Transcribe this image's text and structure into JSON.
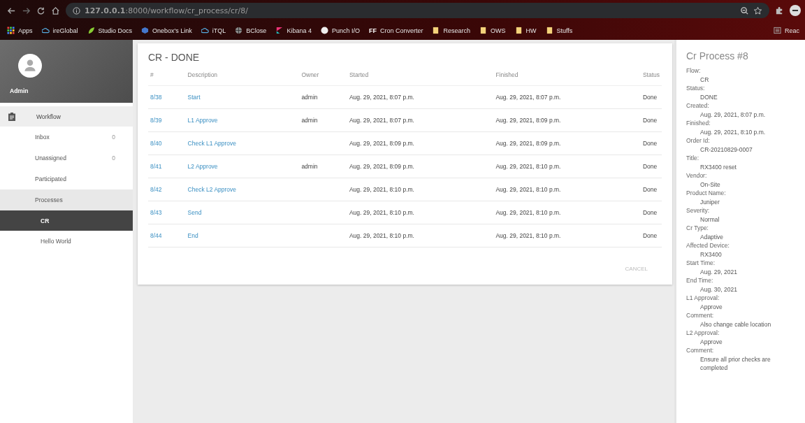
{
  "browser": {
    "url": "**127.0.0.1**:8000/workflow/cr_process/cr/8/",
    "bookmarks": [
      {
        "label": "Apps",
        "kind": "grid"
      },
      {
        "label": "ireGlobal",
        "kind": "cloud"
      },
      {
        "label": "Studio Docs",
        "kind": "leaf"
      },
      {
        "label": "Onebox's Link",
        "kind": "cube"
      },
      {
        "label": "iTQL",
        "kind": "cloud"
      },
      {
        "label": "BClose",
        "kind": "globe"
      },
      {
        "label": "Kibana 4",
        "kind": "kibana"
      },
      {
        "label": "Punch I/O",
        "kind": "disc"
      },
      {
        "label": "Cron Converter",
        "kind": "text",
        "badge": "FF"
      },
      {
        "label": "Research",
        "kind": "folder"
      },
      {
        "label": "OWS",
        "kind": "folder"
      },
      {
        "label": "HW",
        "kind": "folder"
      },
      {
        "label": "Stuffs",
        "kind": "folder"
      }
    ],
    "reading_list": "Reac"
  },
  "sidebar": {
    "user": "Admin",
    "section": "Workflow",
    "items": [
      {
        "label": "Inbox",
        "count": "0",
        "selected": false
      },
      {
        "label": "Unassigned",
        "count": "0",
        "selected": false
      },
      {
        "label": "Participated",
        "selected": false
      },
      {
        "label": "Processes",
        "selected": false,
        "expanded": true,
        "children": [
          {
            "label": "CR",
            "selected": true
          },
          {
            "label": "Hello World",
            "selected": false
          }
        ]
      }
    ]
  },
  "card": {
    "title": "CR - DONE",
    "columns": [
      "#",
      "Description",
      "Owner",
      "Started",
      "Finished",
      "Status"
    ],
    "rows": [
      {
        "id": "8/38",
        "description": "Start",
        "owner": "admin",
        "started": "Aug. 29, 2021, 8:07 p.m.",
        "finished": "Aug. 29, 2021, 8:07 p.m.",
        "status": "Done"
      },
      {
        "id": "8/39",
        "description": "L1 Approve",
        "owner": "admin",
        "started": "Aug. 29, 2021, 8:07 p.m.",
        "finished": "Aug. 29, 2021, 8:09 p.m.",
        "status": "Done"
      },
      {
        "id": "8/40",
        "description": "Check L1 Approve",
        "started": "Aug. 29, 2021, 8:09 p.m.",
        "finished": "Aug. 29, 2021, 8:09 p.m.",
        "status": "Done"
      },
      {
        "id": "8/41",
        "description": "L2 Approve",
        "owner": "admin",
        "started": "Aug. 29, 2021, 8:09 p.m.",
        "finished": "Aug. 29, 2021, 8:10 p.m.",
        "status": "Done"
      },
      {
        "id": "8/42",
        "description": "Check L2 Approve",
        "started": "Aug. 29, 2021, 8:10 p.m.",
        "finished": "Aug. 29, 2021, 8:10 p.m.",
        "status": "Done"
      },
      {
        "id": "8/43",
        "description": "Send",
        "started": "Aug. 29, 2021, 8:10 p.m.",
        "finished": "Aug. 29, 2021, 8:10 p.m.",
        "status": "Done"
      },
      {
        "id": "8/44",
        "description": "End",
        "started": "Aug. 29, 2021, 8:10 p.m.",
        "finished": "Aug. 29, 2021, 8:10 p.m.",
        "status": "Done"
      }
    ],
    "cancel_button": "CANCEL"
  },
  "details": {
    "title": "Cr Process #8",
    "fields": [
      {
        "label": "Flow:",
        "value": "CR"
      },
      {
        "label": "Status:",
        "value": "DONE"
      },
      {
        "label": "Created:",
        "value": "Aug. 29, 2021, 8:07 p.m."
      },
      {
        "label": "Finished:",
        "value": "Aug. 29, 2021, 8:10 p.m."
      },
      {
        "label": "Order Id:",
        "value": "CR-20210829-0007"
      },
      {
        "label": "Title:",
        "value": "RX3400 reset"
      },
      {
        "label": "Vendor:",
        "value": "On-Site"
      },
      {
        "label": "Product Name:",
        "value": "Juniper"
      },
      {
        "label": "Severity:",
        "value": "Normal"
      },
      {
        "label": "Cr Type:",
        "value": "Adaptive"
      },
      {
        "label": "Affected Device:",
        "value": "RX3400"
      },
      {
        "label": "Start Time:",
        "value": "Aug. 29, 2021"
      },
      {
        "label": "End Time:",
        "value": "Aug. 30, 2021"
      },
      {
        "label": "L1 Approval:",
        "value": "Approve"
      },
      {
        "label": "Comment:",
        "value": "Also change cable location"
      },
      {
        "label": "L2 Approval:",
        "value": "Approve"
      },
      {
        "label": "Comment:",
        "value": "Ensure all prior checks are completed"
      }
    ]
  }
}
